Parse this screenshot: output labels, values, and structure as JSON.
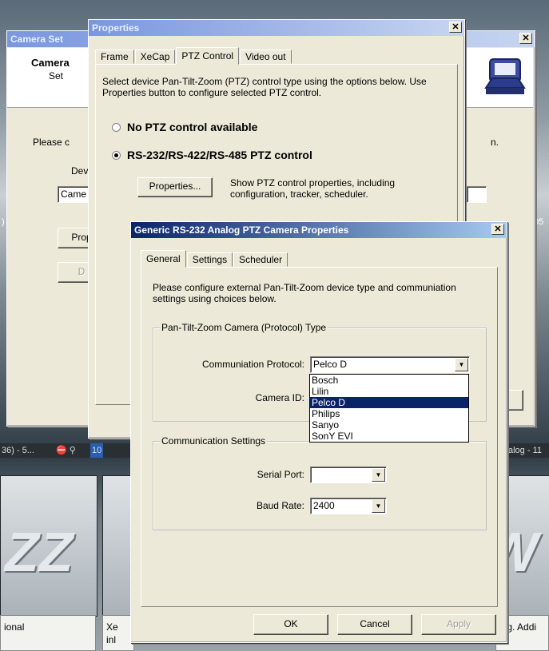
{
  "background": {
    "status_left": "36) - 5...",
    "status_num": "10",
    "status_right": "alog - 11",
    "left_mid": ")",
    "right_mid": "05",
    "caption_left": "ional",
    "caption_mid": "Xe\ninl",
    "caption_right": "ing. Addi"
  },
  "camera_setup": {
    "title": "Camera Set",
    "header_title": "Camera",
    "header_sub": "Set",
    "please_text": "Please c",
    "right_text": "n.",
    "device_label": "Dev",
    "device_value": "Came",
    "prop_button": "Prop",
    "d_button": "D"
  },
  "properties": {
    "title": "Properties",
    "tabs": [
      "Frame",
      "XeCap",
      "PTZ Control",
      "Video out"
    ],
    "active_tab": "PTZ Control",
    "description": "Select device Pan-Tilt-Zoom (PTZ) control type using the options below. Use Properties button to configure selected PTZ control.",
    "radio_none": "No PTZ control available",
    "radio_rs": "RS-232/RS-422/RS-485 PTZ control",
    "selected_radio": "rs",
    "properties_button": "Properties...",
    "properties_help": "Show PTZ control properties, including configuration, tracker, scheduler."
  },
  "generic": {
    "title": "Generic RS-232 Analog PTZ Camera Properties",
    "tabs": [
      "General",
      "Settings",
      "Scheduler"
    ],
    "active_tab": "General",
    "description": "Please configure external Pan-Tilt-Zoom device type and communiation settings using choices below.",
    "group_protocol": "Pan-Tilt-Zoom Camera  (Protocol) Type",
    "protocol_label": "Communiation Protocol:",
    "protocol_value": "Pelco D",
    "protocol_options": [
      "Bosch",
      "Lilin",
      "Pelco D",
      "Philips",
      "Sanyo",
      "SonY EVI"
    ],
    "camera_id_label": "Camera ID:",
    "group_comm": "Communication Settings",
    "serial_port_label": "Serial Port:",
    "serial_port_value": "",
    "baud_rate_label": "Baud Rate:",
    "baud_rate_value": "2400",
    "ok_button": "OK",
    "cancel_button": "Cancel",
    "apply_button": "Apply"
  }
}
